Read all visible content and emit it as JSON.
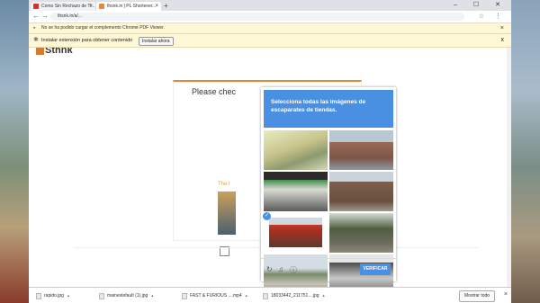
{
  "tabs": [
    {
      "title": "Como Sin Rechazo de Ti...",
      "icon_color": "#d32f2f"
    },
    {
      "title": "thsnk.in | PL Shortener...",
      "icon_color": "#e08a3a"
    }
  ],
  "new_tab_symbol": "+",
  "window_controls": "– ☐ ✕",
  "address": {
    "url": "thsnk.in/a/..."
  },
  "info_bar_pdf": {
    "text": "No se ha podido cargar el complemento Chrome PDF Viewer.",
    "close": "×"
  },
  "info_bar_ext": {
    "text": "Instalar extensión para obtener contenido",
    "button": "Instalar ahora",
    "close": "x"
  },
  "page": {
    "logo": "Sthnk",
    "card_text": "Please chec",
    "thumb_label": "The l"
  },
  "captcha": {
    "header": "Selecciona todas las imágenes de escaparates de tiendas.",
    "verify_label": "VERIFICAR",
    "selected_tile": 5,
    "check_mark": "✓",
    "icons": [
      "refresh-icon",
      "headphones-icon",
      "info-icon"
    ]
  },
  "downloads": {
    "items": [
      "rapido.jpg",
      "mainestefault (1).jpg",
      "FAST & FURIOUS ....mp4",
      "18033442_211751....jpg"
    ],
    "show_all": "Mostrar todo",
    "close": "×"
  },
  "colors": {
    "accent": "#4a90e2",
    "orange": "#e08a3a",
    "infobar": "#fff8d6"
  }
}
